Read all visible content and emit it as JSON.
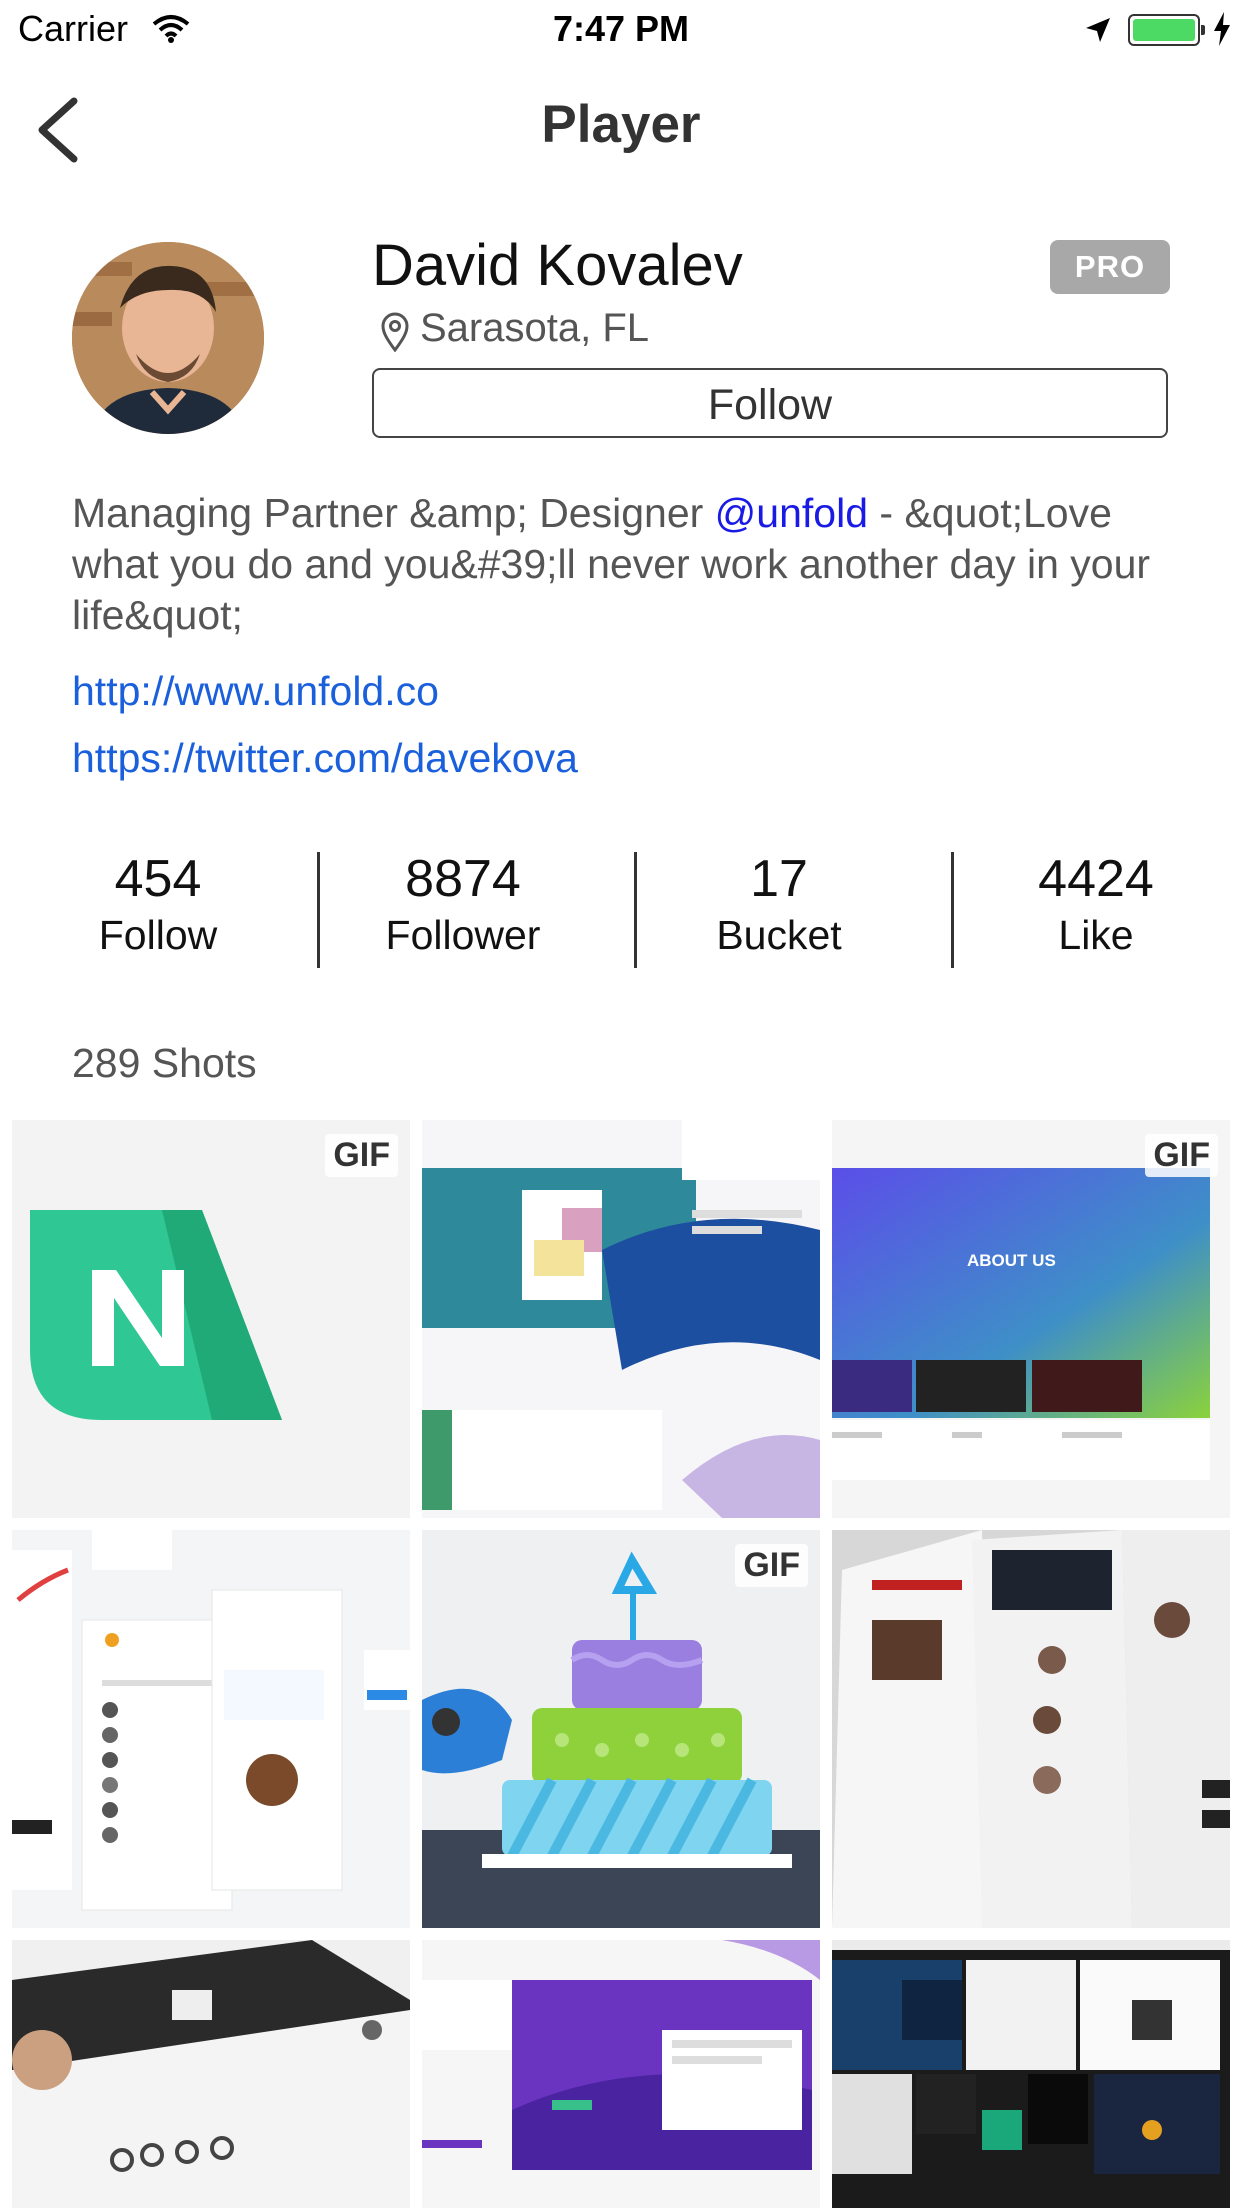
{
  "status_bar": {
    "carrier": "Carrier",
    "time": "7:47 PM"
  },
  "nav": {
    "title": "Player"
  },
  "profile": {
    "name": "David Kovalev",
    "badge": "PRO",
    "location": "Sarasota, FL",
    "follow_label": "Follow",
    "bio_part1": "Managing Partner &amp; Designer ",
    "bio_mention": "@unfold",
    "bio_part2": " - &quot;Love what you do and you&#39;ll never work another day in your life&quot;",
    "links": [
      "http://www.unfold.co",
      "https://twitter.com/davekova"
    ]
  },
  "stats": [
    {
      "value": "454",
      "label": "Follow"
    },
    {
      "value": "8874",
      "label": "Follower"
    },
    {
      "value": "17",
      "label": "Bucket"
    },
    {
      "value": "4424",
      "label": "Like"
    }
  ],
  "shots": {
    "count_label": "289 Shots",
    "gif_badge": "GIF",
    "tiles": [
      {
        "name": "n-logo",
        "gif": true
      },
      {
        "name": "landing-page",
        "gif": false
      },
      {
        "name": "about-us",
        "gif": true,
        "text": "ABOUT US"
      },
      {
        "name": "top-users",
        "gif": false
      },
      {
        "name": "birthday-cake",
        "gif": true
      },
      {
        "name": "leaderboard",
        "gif": false
      },
      {
        "name": "profile-app",
        "gif": false
      },
      {
        "name": "writing-software",
        "gif": false
      },
      {
        "name": "monitor-grid",
        "gif": false
      }
    ]
  },
  "colors": {
    "link": "#1a5fdc",
    "mention": "#1a1ae6",
    "badge": "#a8a8a8"
  }
}
